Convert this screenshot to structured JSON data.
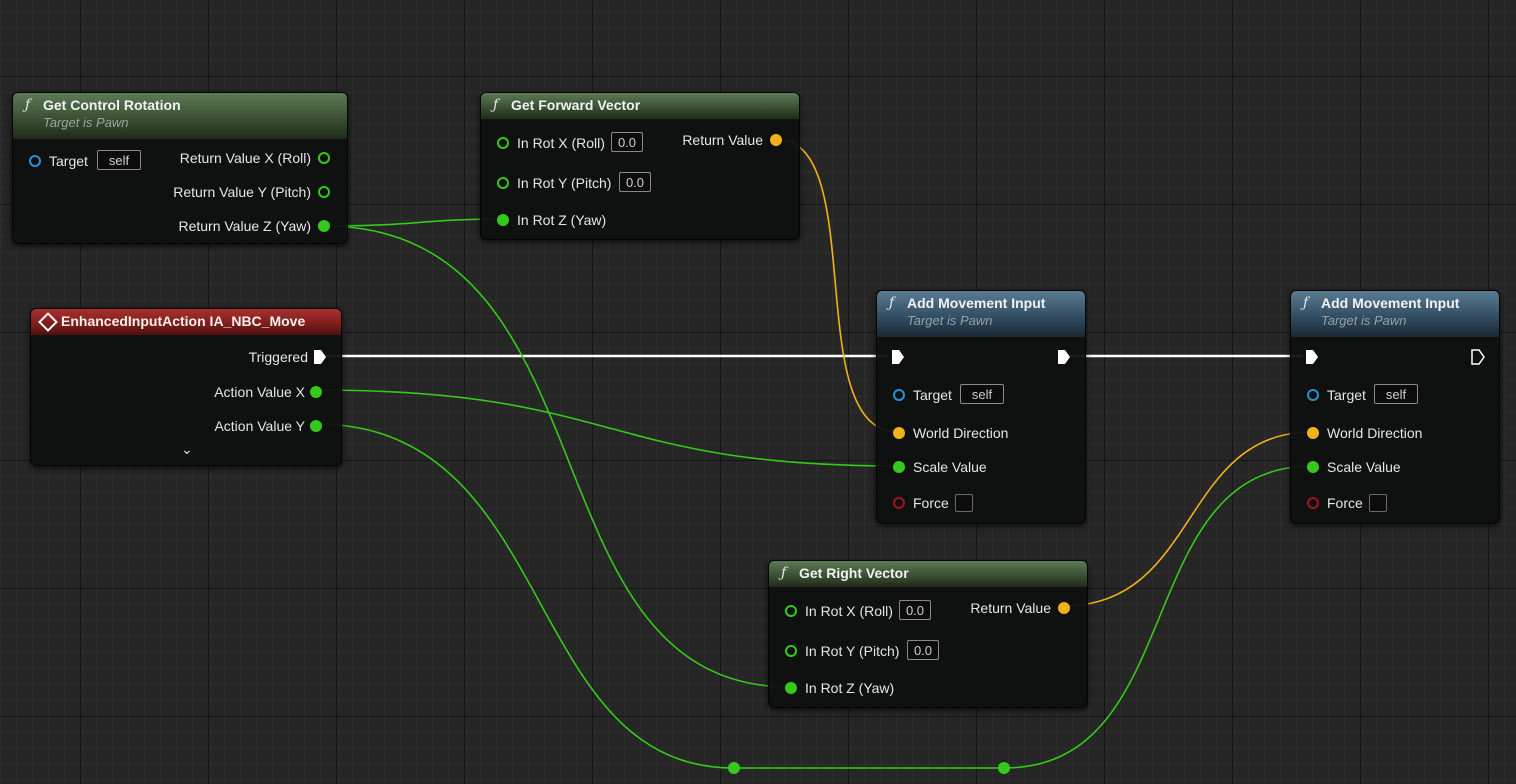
{
  "nodes": {
    "get_control_rotation": {
      "title": "Get Control Rotation",
      "subtitle": "Target is Pawn",
      "target_label": "Target",
      "target_value": "self",
      "outputs": [
        "Return Value X (Roll)",
        "Return Value Y (Pitch)",
        "Return Value Z (Yaw)"
      ]
    },
    "get_forward_vector": {
      "title": "Get Forward Vector",
      "inputs": [
        "In Rot X (Roll)",
        "In Rot Y (Pitch)",
        "In Rot Z (Yaw)"
      ],
      "input_values": [
        "0.0",
        "0.0"
      ],
      "output": "Return Value"
    },
    "enhanced_input_action": {
      "title": "EnhancedInputAction IA_NBC_Move",
      "outputs": [
        "Triggered",
        "Action Value X",
        "Action Value Y"
      ],
      "expand_glyph": "⌄"
    },
    "add_movement_input_1": {
      "title": "Add Movement Input",
      "subtitle": "Target is Pawn",
      "target_label": "Target",
      "target_value": "self",
      "inputs": [
        "World Direction",
        "Scale Value",
        "Force"
      ]
    },
    "add_movement_input_2": {
      "title": "Add Movement Input",
      "subtitle": "Target is Pawn",
      "target_label": "Target",
      "target_value": "self",
      "inputs": [
        "World Direction",
        "Scale Value",
        "Force"
      ]
    },
    "get_right_vector": {
      "title": "Get Right Vector",
      "inputs": [
        "In Rot X (Roll)",
        "In Rot Y (Pitch)",
        "In Rot Z (Yaw)"
      ],
      "input_values": [
        "0.0",
        "0.0"
      ],
      "output": "Return Value"
    }
  },
  "icons": {
    "function": "ƒ",
    "pin_float": "green-circle",
    "pin_vector": "yellow-circle",
    "pin_object": "blue-ring",
    "pin_bool": "red-ring",
    "pin_exec": "white-arrow"
  },
  "colors": {
    "float_wire": "#35c91b",
    "vector_wire": "#f0b21b",
    "exec_wire": "#ffffff",
    "object_pin": "#2d8fd2",
    "bool_pin": "#a3141b"
  }
}
